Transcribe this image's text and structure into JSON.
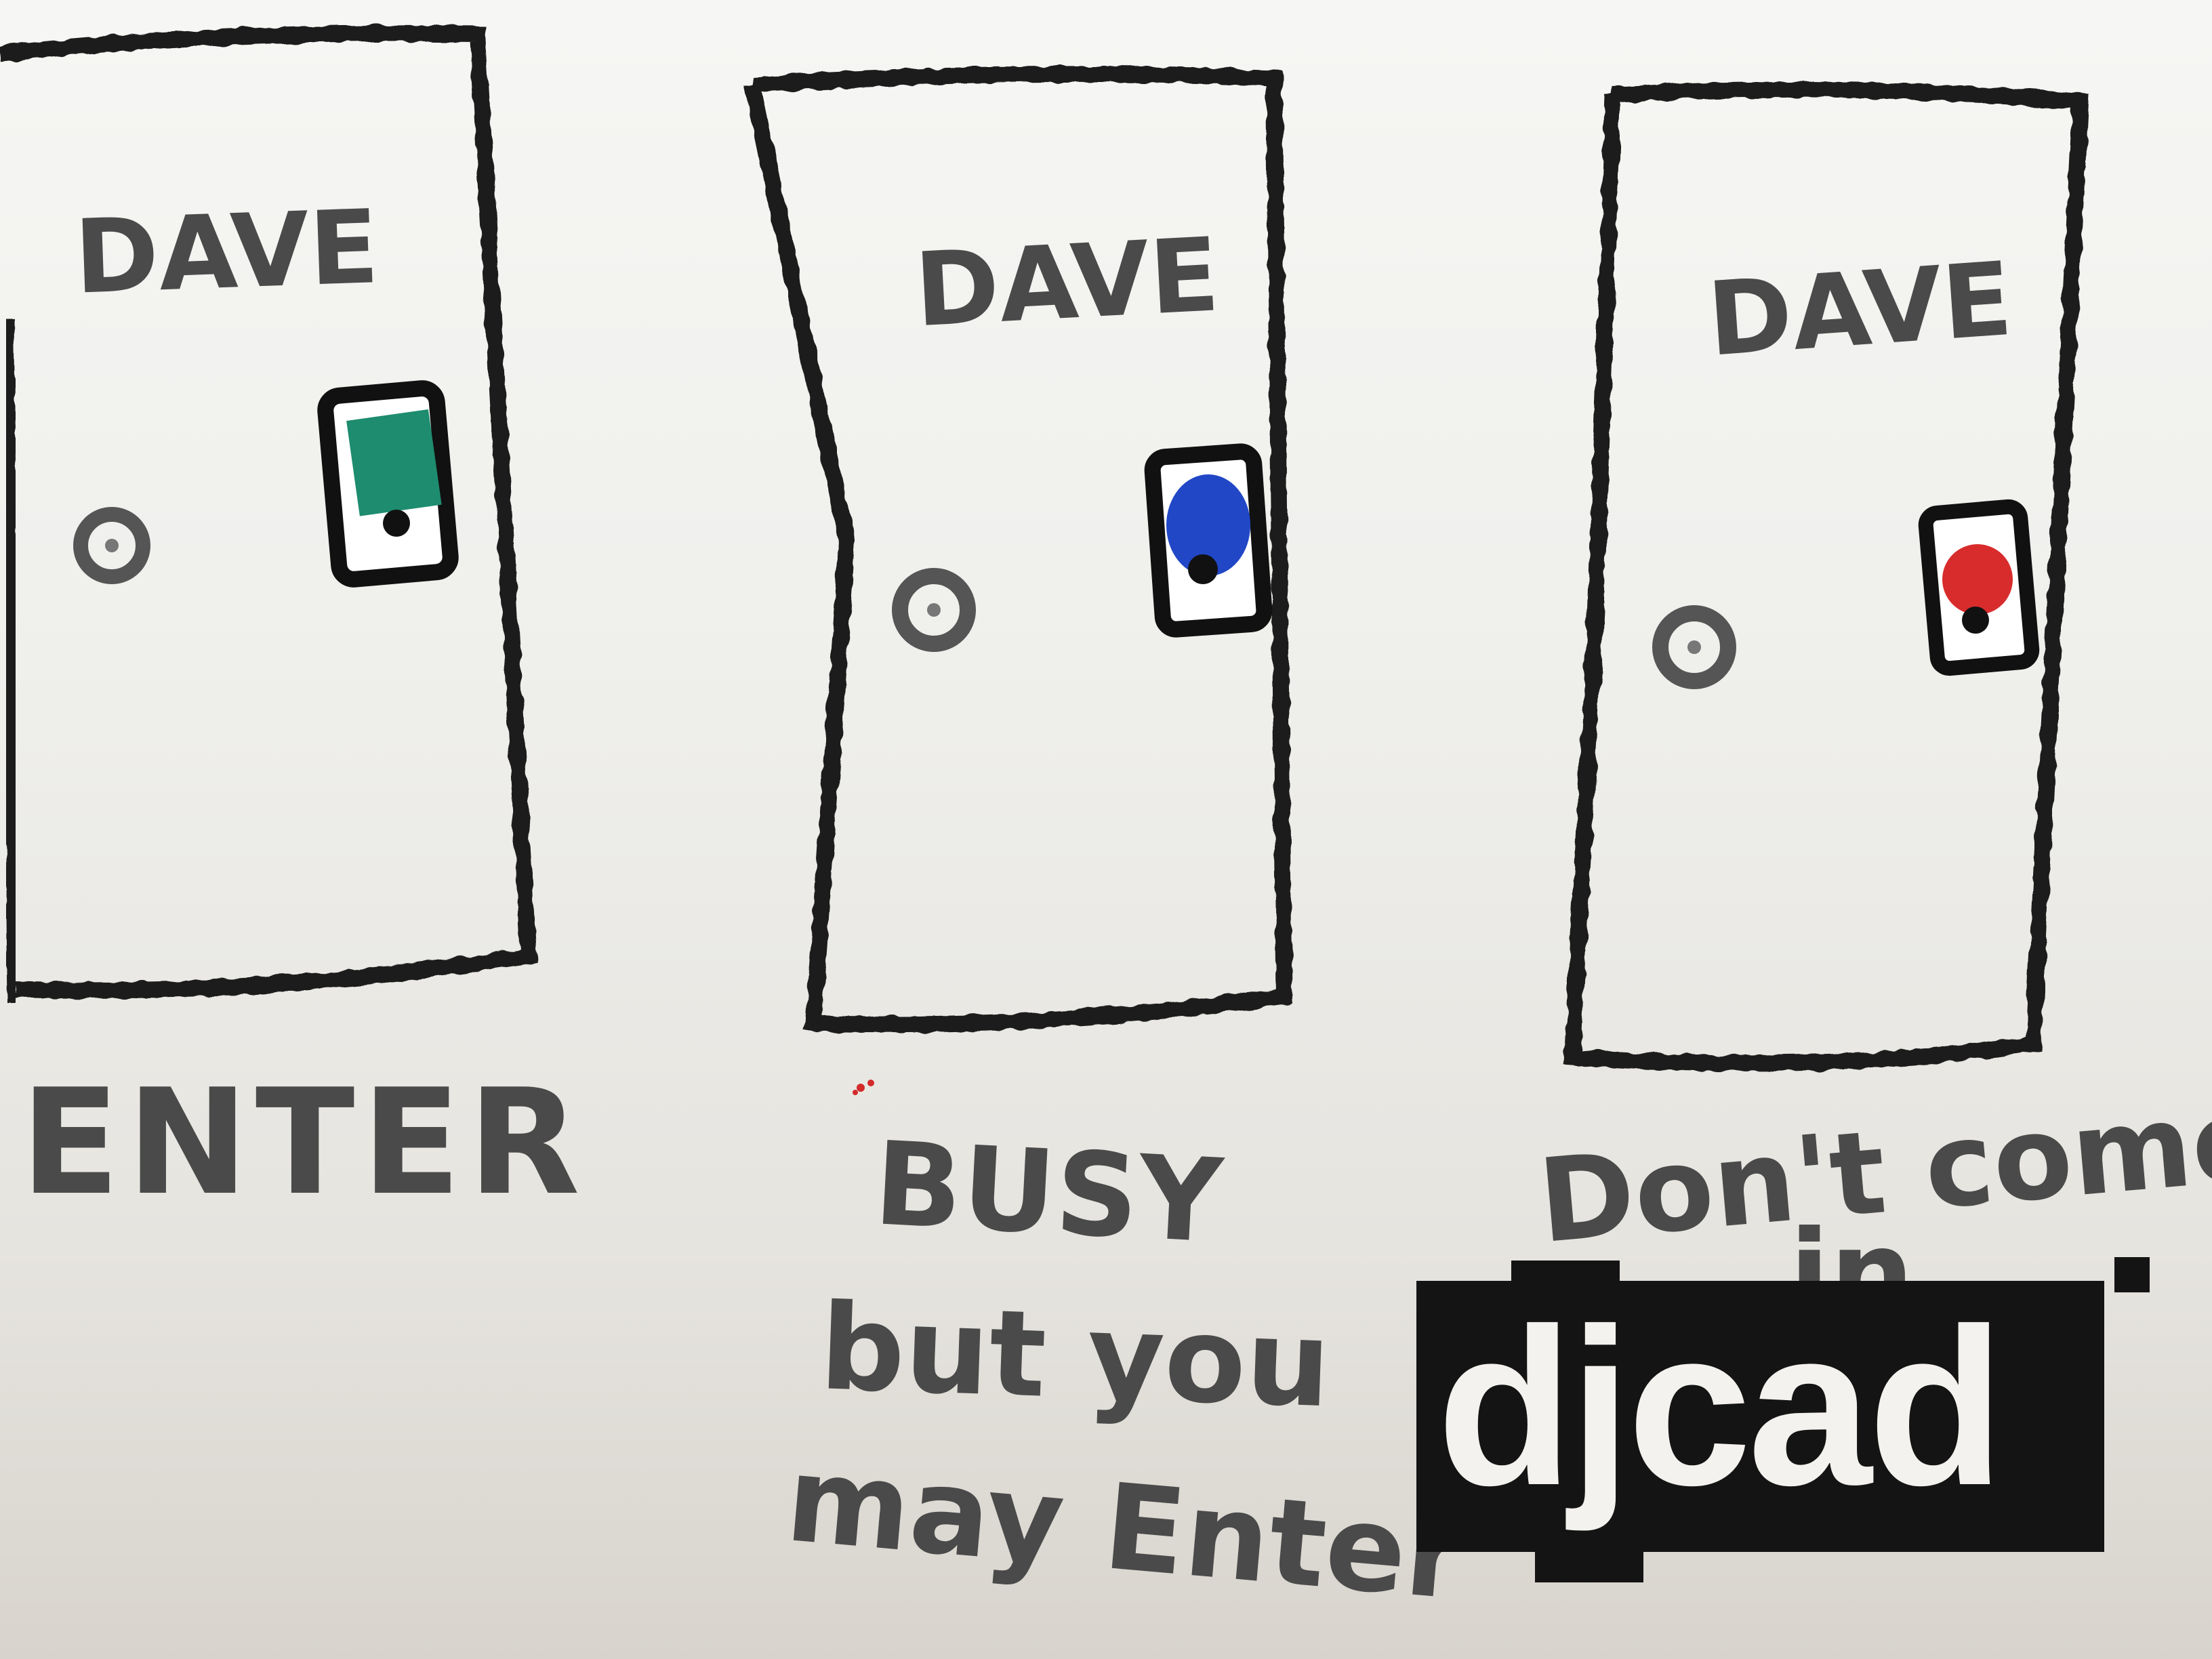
{
  "doors": [
    {
      "name": "DAVE",
      "status_label": "ENTER",
      "indicator_color": "#1e8c6e"
    },
    {
      "name": "DAVE",
      "status_label": "BUSY but you may Enter",
      "indicator_color": "#2147c6"
    },
    {
      "name": "DAVE",
      "status_label": "Don't come in",
      "indicator_color": "#d82c2c"
    }
  ],
  "labels": {
    "enter": "ENTER",
    "busy_1": "BUSY",
    "busy_2": "but you",
    "busy_3": "may Enter",
    "dont_1": "Don't come",
    "dont_2": "in"
  },
  "logo": {
    "text": "djcad"
  },
  "colors": {
    "paper": "#f2f2f0",
    "marker_black": "#1c1c1c",
    "pencil_grey": "#555555",
    "logo_bg": "#141414"
  }
}
